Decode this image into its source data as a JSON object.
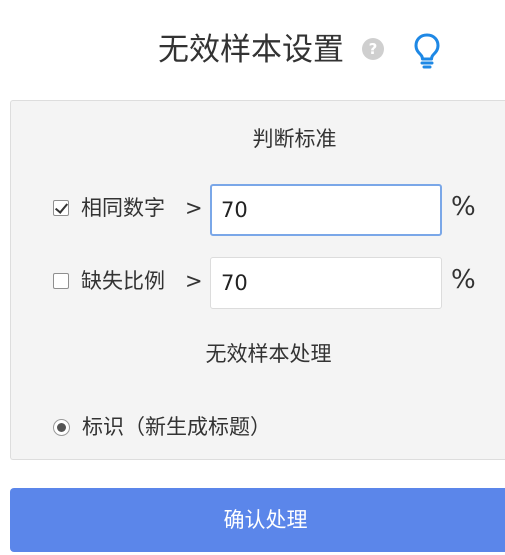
{
  "header": {
    "title": "无效样本设置",
    "help_icon": "question-circle-icon",
    "help_glyph": "?",
    "tip_icon": "lightbulb-icon",
    "accent_color": "#1e88e5"
  },
  "criteria": {
    "title": "判断标准",
    "rows": [
      {
        "label": "相同数字",
        "checked": true,
        "operator": ">",
        "value": "70",
        "unit": "%"
      },
      {
        "label": "缺失比例",
        "checked": false,
        "operator": ">",
        "value": "70",
        "unit": "%"
      }
    ]
  },
  "processing": {
    "title": "无效样本处理",
    "options": [
      {
        "label": "标识（新生成标题）",
        "selected": true
      }
    ]
  },
  "confirm": {
    "label": "确认处理",
    "color": "#5b86ea"
  }
}
